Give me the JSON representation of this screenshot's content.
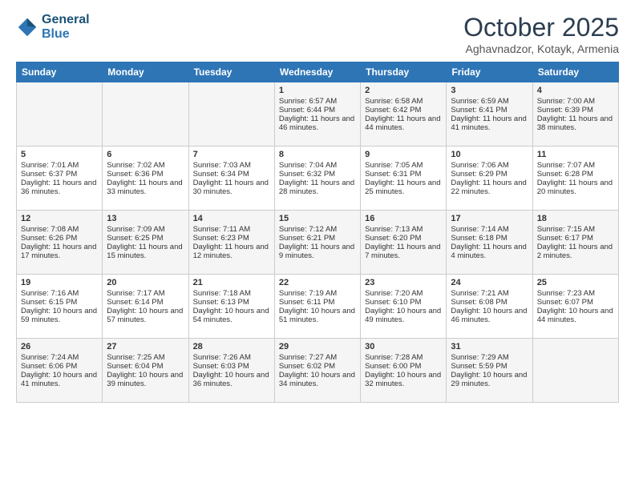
{
  "header": {
    "logo_line1": "General",
    "logo_line2": "Blue",
    "month": "October 2025",
    "location": "Aghavnadzor, Kotayk, Armenia"
  },
  "days_of_week": [
    "Sunday",
    "Monday",
    "Tuesday",
    "Wednesday",
    "Thursday",
    "Friday",
    "Saturday"
  ],
  "weeks": [
    [
      {
        "day": "",
        "content": ""
      },
      {
        "day": "",
        "content": ""
      },
      {
        "day": "",
        "content": ""
      },
      {
        "day": "1",
        "content": "Sunrise: 6:57 AM\nSunset: 6:44 PM\nDaylight: 11 hours and 46 minutes."
      },
      {
        "day": "2",
        "content": "Sunrise: 6:58 AM\nSunset: 6:42 PM\nDaylight: 11 hours and 44 minutes."
      },
      {
        "day": "3",
        "content": "Sunrise: 6:59 AM\nSunset: 6:41 PM\nDaylight: 11 hours and 41 minutes."
      },
      {
        "day": "4",
        "content": "Sunrise: 7:00 AM\nSunset: 6:39 PM\nDaylight: 11 hours and 38 minutes."
      }
    ],
    [
      {
        "day": "5",
        "content": "Sunrise: 7:01 AM\nSunset: 6:37 PM\nDaylight: 11 hours and 36 minutes."
      },
      {
        "day": "6",
        "content": "Sunrise: 7:02 AM\nSunset: 6:36 PM\nDaylight: 11 hours and 33 minutes."
      },
      {
        "day": "7",
        "content": "Sunrise: 7:03 AM\nSunset: 6:34 PM\nDaylight: 11 hours and 30 minutes."
      },
      {
        "day": "8",
        "content": "Sunrise: 7:04 AM\nSunset: 6:32 PM\nDaylight: 11 hours and 28 minutes."
      },
      {
        "day": "9",
        "content": "Sunrise: 7:05 AM\nSunset: 6:31 PM\nDaylight: 11 hours and 25 minutes."
      },
      {
        "day": "10",
        "content": "Sunrise: 7:06 AM\nSunset: 6:29 PM\nDaylight: 11 hours and 22 minutes."
      },
      {
        "day": "11",
        "content": "Sunrise: 7:07 AM\nSunset: 6:28 PM\nDaylight: 11 hours and 20 minutes."
      }
    ],
    [
      {
        "day": "12",
        "content": "Sunrise: 7:08 AM\nSunset: 6:26 PM\nDaylight: 11 hours and 17 minutes."
      },
      {
        "day": "13",
        "content": "Sunrise: 7:09 AM\nSunset: 6:25 PM\nDaylight: 11 hours and 15 minutes."
      },
      {
        "day": "14",
        "content": "Sunrise: 7:11 AM\nSunset: 6:23 PM\nDaylight: 11 hours and 12 minutes."
      },
      {
        "day": "15",
        "content": "Sunrise: 7:12 AM\nSunset: 6:21 PM\nDaylight: 11 hours and 9 minutes."
      },
      {
        "day": "16",
        "content": "Sunrise: 7:13 AM\nSunset: 6:20 PM\nDaylight: 11 hours and 7 minutes."
      },
      {
        "day": "17",
        "content": "Sunrise: 7:14 AM\nSunset: 6:18 PM\nDaylight: 11 hours and 4 minutes."
      },
      {
        "day": "18",
        "content": "Sunrise: 7:15 AM\nSunset: 6:17 PM\nDaylight: 11 hours and 2 minutes."
      }
    ],
    [
      {
        "day": "19",
        "content": "Sunrise: 7:16 AM\nSunset: 6:15 PM\nDaylight: 10 hours and 59 minutes."
      },
      {
        "day": "20",
        "content": "Sunrise: 7:17 AM\nSunset: 6:14 PM\nDaylight: 10 hours and 57 minutes."
      },
      {
        "day": "21",
        "content": "Sunrise: 7:18 AM\nSunset: 6:13 PM\nDaylight: 10 hours and 54 minutes."
      },
      {
        "day": "22",
        "content": "Sunrise: 7:19 AM\nSunset: 6:11 PM\nDaylight: 10 hours and 51 minutes."
      },
      {
        "day": "23",
        "content": "Sunrise: 7:20 AM\nSunset: 6:10 PM\nDaylight: 10 hours and 49 minutes."
      },
      {
        "day": "24",
        "content": "Sunrise: 7:21 AM\nSunset: 6:08 PM\nDaylight: 10 hours and 46 minutes."
      },
      {
        "day": "25",
        "content": "Sunrise: 7:23 AM\nSunset: 6:07 PM\nDaylight: 10 hours and 44 minutes."
      }
    ],
    [
      {
        "day": "26",
        "content": "Sunrise: 7:24 AM\nSunset: 6:06 PM\nDaylight: 10 hours and 41 minutes."
      },
      {
        "day": "27",
        "content": "Sunrise: 7:25 AM\nSunset: 6:04 PM\nDaylight: 10 hours and 39 minutes."
      },
      {
        "day": "28",
        "content": "Sunrise: 7:26 AM\nSunset: 6:03 PM\nDaylight: 10 hours and 36 minutes."
      },
      {
        "day": "29",
        "content": "Sunrise: 7:27 AM\nSunset: 6:02 PM\nDaylight: 10 hours and 34 minutes."
      },
      {
        "day": "30",
        "content": "Sunrise: 7:28 AM\nSunset: 6:00 PM\nDaylight: 10 hours and 32 minutes."
      },
      {
        "day": "31",
        "content": "Sunrise: 7:29 AM\nSunset: 5:59 PM\nDaylight: 10 hours and 29 minutes."
      },
      {
        "day": "",
        "content": ""
      }
    ]
  ]
}
